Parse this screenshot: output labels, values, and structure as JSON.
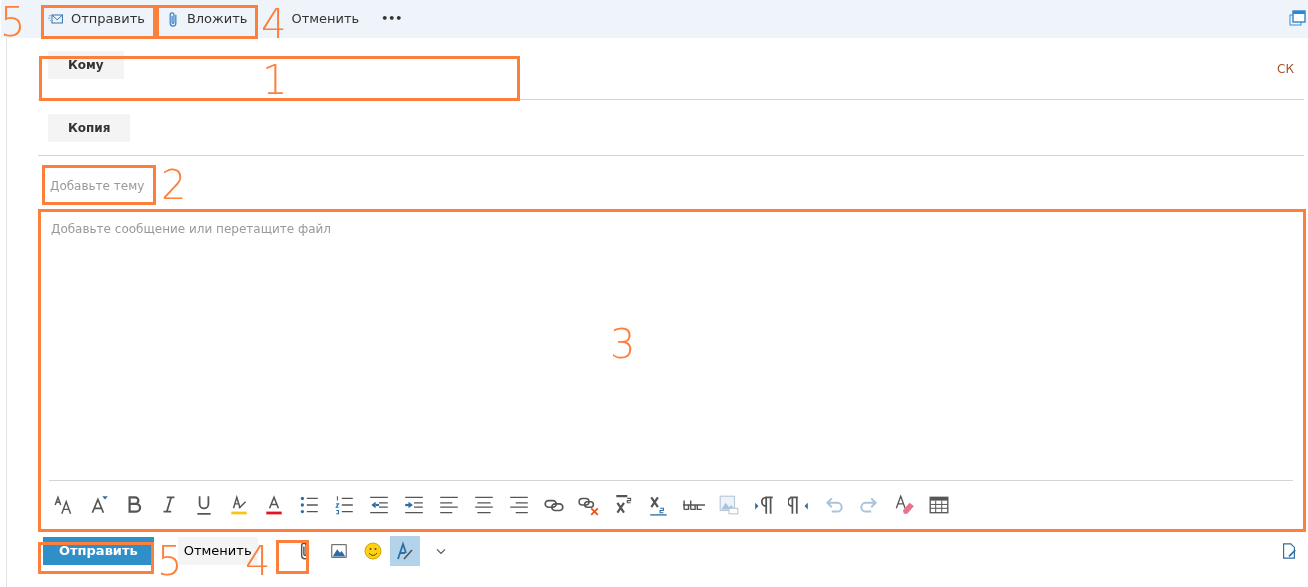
{
  "toolbar": {
    "send": "Отправить",
    "attach": "Вложить",
    "cancel": "Отменить",
    "more": "•••"
  },
  "to": {
    "label": "Кому",
    "bcc": "СК"
  },
  "cc": {
    "label": "Копия"
  },
  "subject": {
    "placeholder": "Добавьте тему"
  },
  "body": {
    "placeholder": "Добавьте сообщение или перетащите файл"
  },
  "bottom": {
    "send": "Отправить",
    "cancel": "Отменить",
    "format_toggle": {
      "selected": true
    }
  },
  "annotations": [
    {
      "number": "5"
    },
    {
      "number": "4"
    },
    {
      "number": "1"
    },
    {
      "number": "2"
    },
    {
      "number": "3"
    },
    {
      "number": "5"
    },
    {
      "number": "4"
    }
  ]
}
